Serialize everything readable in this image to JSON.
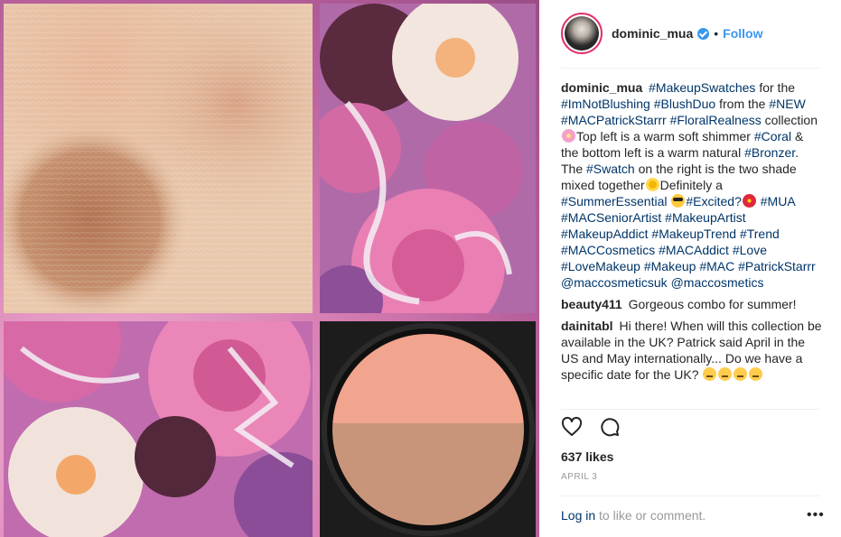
{
  "post": {
    "author": {
      "username": "dominic_mua",
      "verified": true,
      "follow_label": "Follow",
      "separator": "•"
    },
    "caption": {
      "username": "dominic_mua",
      "segments": [
        {
          "t": "tag",
          "v": "#MakeupSwatches"
        },
        {
          "t": "text",
          "v": " for the "
        },
        {
          "t": "tag",
          "v": "#ImNotBlushing"
        },
        {
          "t": "text",
          "v": " "
        },
        {
          "t": "tag",
          "v": "#BlushDuo"
        },
        {
          "t": "text",
          "v": " from the "
        },
        {
          "t": "tag",
          "v": "#NEW"
        },
        {
          "t": "text",
          "v": " "
        },
        {
          "t": "tag",
          "v": "#MACPatrickStarrr"
        },
        {
          "t": "text",
          "v": " "
        },
        {
          "t": "tag",
          "v": "#FloralRealness"
        },
        {
          "t": "text",
          "v": " collection"
        },
        {
          "t": "emoji",
          "v": "blossom"
        },
        {
          "t": "text",
          "v": "Top left is a warm soft shimmer "
        },
        {
          "t": "tag",
          "v": "#Coral"
        },
        {
          "t": "text",
          "v": " & the bottom left is a warm natural "
        },
        {
          "t": "tag",
          "v": "#Bronzer"
        },
        {
          "t": "text",
          "v": ". The "
        },
        {
          "t": "tag",
          "v": "#Swatch"
        },
        {
          "t": "text",
          "v": " on the right is the two shade mixed together"
        },
        {
          "t": "emoji",
          "v": "sun"
        },
        {
          "t": "text",
          "v": "Definitely a "
        },
        {
          "t": "tag",
          "v": "#SummerEssential"
        },
        {
          "t": "text",
          "v": " "
        },
        {
          "t": "emoji",
          "v": "cool"
        },
        {
          "t": "tag",
          "v": "#Excited?"
        },
        {
          "t": "emoji",
          "v": "hib"
        },
        {
          "t": "text",
          "v": " "
        },
        {
          "t": "tag",
          "v": "#MUA"
        },
        {
          "t": "text",
          "v": " "
        },
        {
          "t": "tag",
          "v": "#MACSeniorArtist"
        },
        {
          "t": "text",
          "v": " "
        },
        {
          "t": "tag",
          "v": "#MakeupArtist"
        },
        {
          "t": "text",
          "v": " "
        },
        {
          "t": "tag",
          "v": "#MakeupAddict"
        },
        {
          "t": "text",
          "v": " "
        },
        {
          "t": "tag",
          "v": "#MakeupTrend"
        },
        {
          "t": "text",
          "v": " "
        },
        {
          "t": "tag",
          "v": "#Trend"
        },
        {
          "t": "text",
          "v": " "
        },
        {
          "t": "tag",
          "v": "#MACCosmetics"
        },
        {
          "t": "text",
          "v": " "
        },
        {
          "t": "tag",
          "v": "#MACAddict"
        },
        {
          "t": "text",
          "v": " "
        },
        {
          "t": "tag",
          "v": "#Love"
        },
        {
          "t": "text",
          "v": " "
        },
        {
          "t": "tag",
          "v": "#LoveMakeup"
        },
        {
          "t": "text",
          "v": " "
        },
        {
          "t": "tag",
          "v": "#Makeup"
        },
        {
          "t": "text",
          "v": " "
        },
        {
          "t": "tag",
          "v": "#MAC"
        },
        {
          "t": "text",
          "v": " "
        },
        {
          "t": "tag",
          "v": "#PatrickStarrr"
        },
        {
          "t": "text",
          "v": " "
        },
        {
          "t": "tag",
          "v": "@maccosmeticsuk"
        },
        {
          "t": "text",
          "v": " "
        },
        {
          "t": "tag",
          "v": "@maccosmetics"
        }
      ]
    },
    "comments": [
      {
        "username": "beauty411",
        "segments": [
          {
            "t": "text",
            "v": "Gorgeous combo for summer!"
          }
        ]
      },
      {
        "username": "dainitabl",
        "segments": [
          {
            "t": "text",
            "v": "Hi there! When will this collection be available in the UK? Patrick said April in the US and May internationally... Do we have a specific date for the UK? "
          },
          {
            "t": "emoji",
            "v": "face"
          },
          {
            "t": "emoji",
            "v": "face"
          },
          {
            "t": "emoji",
            "v": "face"
          },
          {
            "t": "emoji",
            "v": "face"
          }
        ]
      }
    ],
    "likes": "637 likes",
    "date": "APRIL 3",
    "login_link": "Log in",
    "login_rest": " to like or comment.",
    "more_label": "•••",
    "icons": {
      "like": "heart-icon",
      "comment": "comment-bubble-icon",
      "verified": "verified-badge-icon",
      "more": "more-options-icon"
    },
    "colors": {
      "link": "#003569",
      "follow": "#3897f0",
      "text": "#262626",
      "muted": "#999999",
      "divider": "#efefef"
    }
  }
}
